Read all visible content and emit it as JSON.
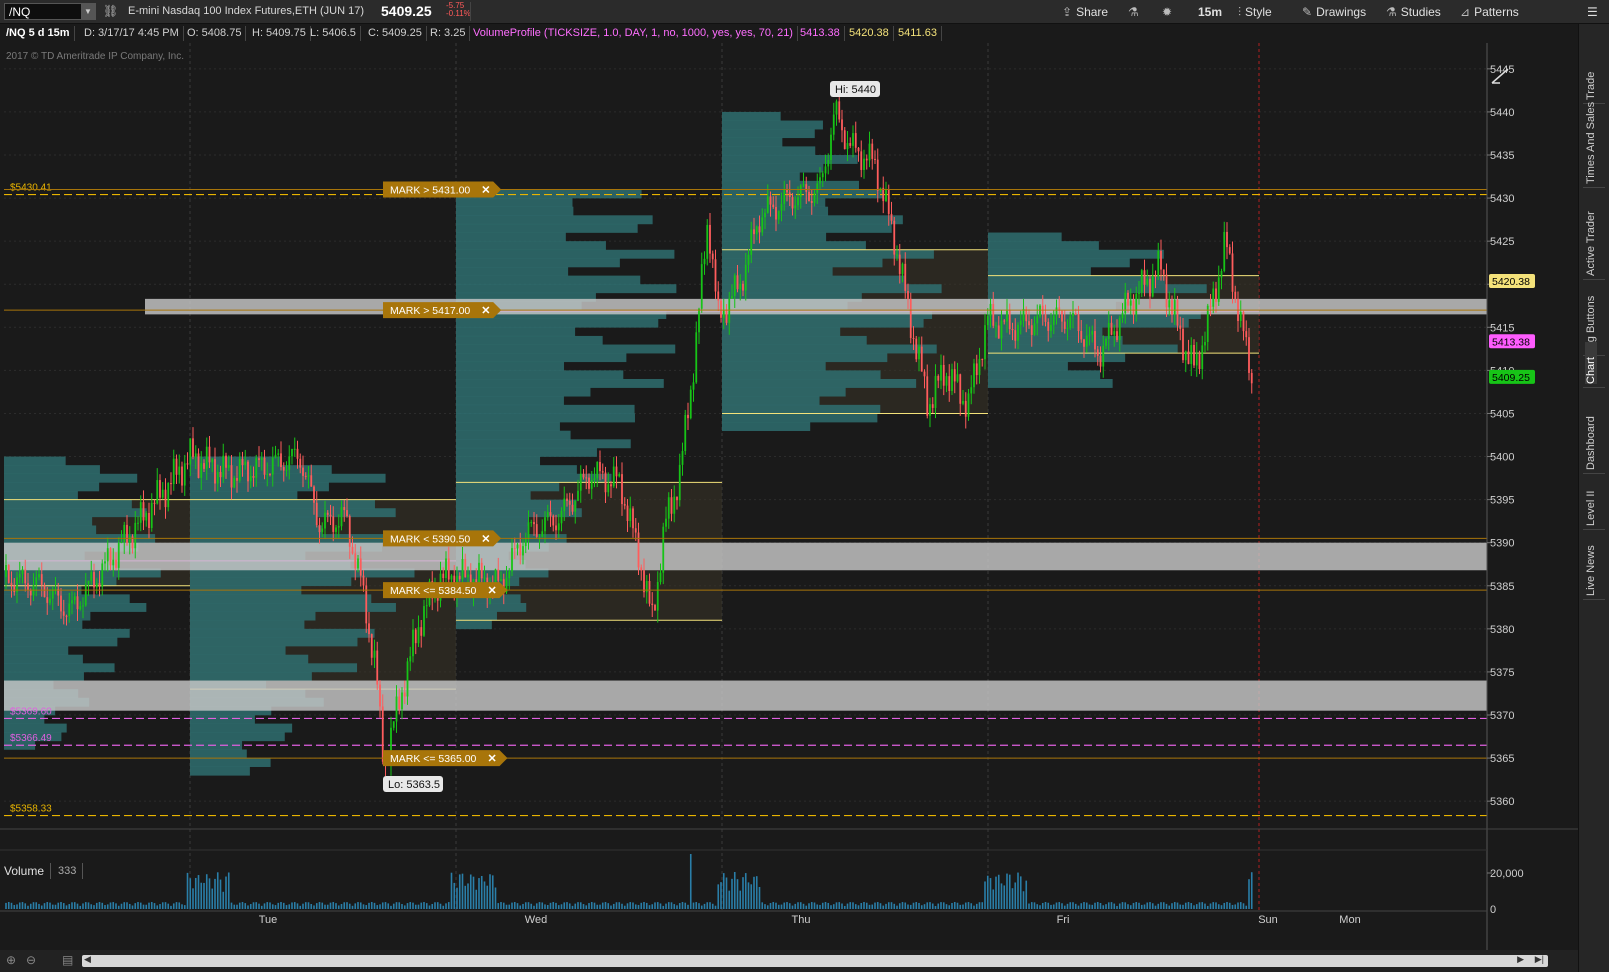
{
  "header": {
    "symbol": "/NQ",
    "description": "E-mini Nasdaq 100 Index Futures,ETH (JUN 17)",
    "last_price": "5409.25",
    "net_change": "-5.75",
    "pct_change": "-0.11%",
    "buttons": {
      "share": "Share",
      "timeframe": "15m",
      "style": "Style",
      "drawings": "Drawings",
      "studies": "Studies",
      "patterns": "Patterns"
    }
  },
  "info_bar": {
    "chart_label": "/NQ 5 d 15m",
    "date": "D: 3/17/17 4:45 PM",
    "open": "O: 5408.75",
    "high": "H: 5409.75",
    "low": "L: 5406.5",
    "close": "C: 5409.25",
    "range": "R: 3.25",
    "study": "VolumeProfile (TICKSIZE, 1.0, DAY, 1, no, 1000, yes, yes, 70, 21)",
    "study_v1": "5413.38",
    "study_v2": "5420.38",
    "study_v3": "5411.63"
  },
  "copyright": "2017 © TD Ameritrade IP Company, Inc.",
  "chart_data": {
    "type": "candlestick",
    "x_labels": [
      "Tue",
      "Wed",
      "Thu",
      "Fri",
      "Sun",
      "Mon"
    ],
    "y_ticks": [
      5445,
      5440,
      5435,
      5430,
      5425,
      5420,
      5415,
      5410,
      5405,
      5400,
      5395,
      5390,
      5385,
      5380,
      5375,
      5370,
      5365,
      5360
    ],
    "ylim": [
      5357,
      5448
    ],
    "high_label": "Hi: 5440",
    "low_label": "Lo: 5363.5",
    "price_bubbles": [
      {
        "text": "5420.38",
        "value": 5420.38,
        "color": "#f4e27a"
      },
      {
        "text": "5413.38",
        "value": 5413.38,
        "color": "#ff5cff"
      },
      {
        "text": "5409.25",
        "value": 5409.25,
        "color": "#17c417"
      }
    ],
    "horizontal_levels": [
      {
        "label": "$5430.41",
        "value": 5430.41,
        "color": "#e8b400",
        "style": "dashed"
      },
      {
        "label": "$5369.60",
        "value": 5369.6,
        "color": "#e060e0",
        "style": "dashed"
      },
      {
        "label": "$5366.49",
        "value": 5366.49,
        "color": "#e060e0",
        "style": "dashed"
      },
      {
        "label": "$5358.33",
        "value": 5358.33,
        "color": "#e8b400",
        "style": "dashed"
      }
    ],
    "alerts": [
      {
        "text": "MARK > 5431.00",
        "value": 5431.0
      },
      {
        "text": "MARK > 5417.00",
        "value": 5417.0
      },
      {
        "text": "MARK < 5390.50",
        "value": 5390.5
      },
      {
        "text": "MARK <= 5384.50",
        "value": 5384.5
      },
      {
        "text": "MARK <= 5365.00",
        "value": 5365.0
      }
    ],
    "zones": [
      {
        "from": 5416.5,
        "to": 5418.3
      },
      {
        "from": 5386.8,
        "to": 5390.0
      },
      {
        "from": 5370.5,
        "to": 5374.0
      }
    ],
    "volume": {
      "label": "Volume",
      "current": "333",
      "y_ticks": [
        "20,000",
        "0"
      ]
    }
  },
  "side_tabs": [
    "Trade",
    "Times And Sales",
    "Active Trader",
    "Big Buttons",
    "Chart",
    "Dashboard",
    "Level II",
    "Live News"
  ],
  "colors": {
    "up": "#17c417",
    "down": "#ff5c5c",
    "profile": "#2f6e70",
    "alert": "#a8750a"
  }
}
